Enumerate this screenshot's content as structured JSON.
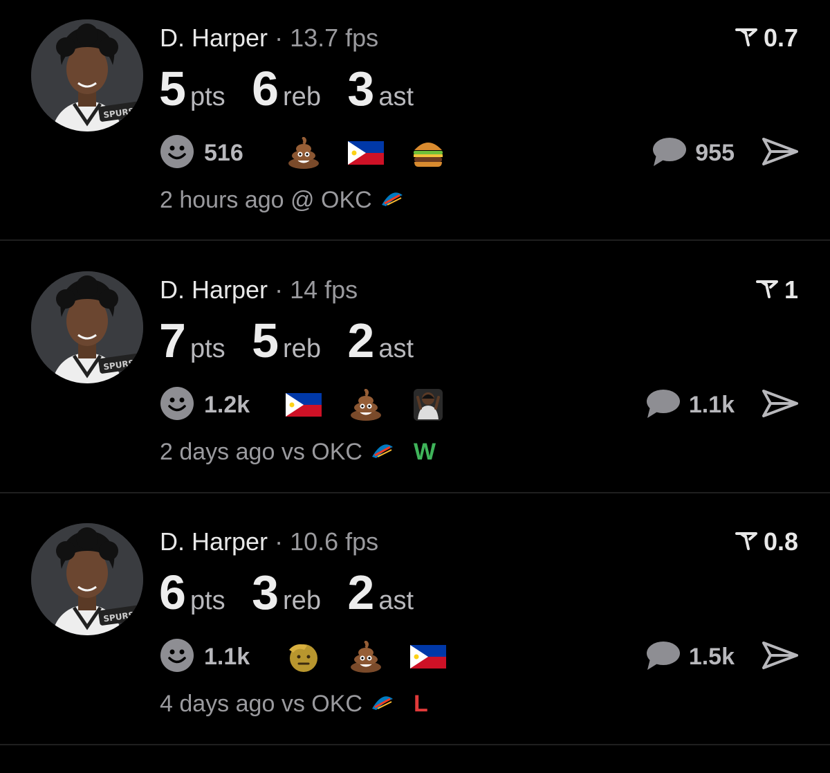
{
  "feed": [
    {
      "player": "D. Harper",
      "separator": "·",
      "fps": "13.7 fps",
      "score": "0.7",
      "stats": [
        {
          "value": "5",
          "label": "pts"
        },
        {
          "value": "6",
          "label": "reb"
        },
        {
          "value": "3",
          "label": "ast"
        }
      ],
      "reaction_count": "516",
      "reactions": [
        "poop-emoji",
        "philippines-flag-emoji",
        "burger-emoji"
      ],
      "comment_count": "955",
      "time": "2 hours ago",
      "venue": "@ OKC",
      "result": ""
    },
    {
      "player": "D. Harper",
      "separator": "·",
      "fps": "14 fps",
      "score": "1",
      "stats": [
        {
          "value": "7",
          "label": "pts"
        },
        {
          "value": "5",
          "label": "reb"
        },
        {
          "value": "2",
          "label": "ast"
        }
      ],
      "reaction_count": "1.2k",
      "reactions": [
        "philippines-flag-emoji",
        "poop-emoji",
        "player-sticker"
      ],
      "comment_count": "1.1k",
      "time": "2 days ago",
      "venue": "vs OKC",
      "result": "W"
    },
    {
      "player": "D. Harper",
      "separator": "·",
      "fps": "10.6 fps",
      "score": "0.8",
      "stats": [
        {
          "value": "6",
          "label": "pts"
        },
        {
          "value": "3",
          "label": "reb"
        },
        {
          "value": "2",
          "label": "ast"
        }
      ],
      "reaction_count": "1.1k",
      "reactions": [
        "saluting-face-emoji",
        "poop-emoji",
        "philippines-flag-emoji"
      ],
      "comment_count": "1.5k",
      "time": "4 days ago",
      "venue": "vs OKC",
      "result": "L"
    }
  ],
  "colors": {
    "background": "#000000",
    "win": "#3fb45a",
    "loss": "#e03a3a",
    "muted": "#9a9a9e"
  },
  "icons": [
    "smiley-icon",
    "comment-bubble-icon",
    "share-arrow-icon",
    "score-icon",
    "okc-logo-icon",
    "spurs-logo"
  ]
}
